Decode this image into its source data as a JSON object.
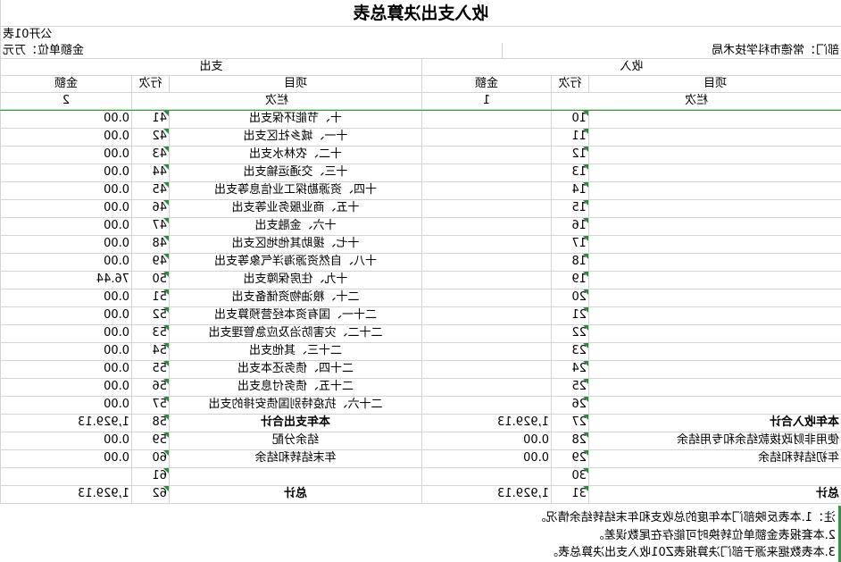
{
  "title": "收入支出决算总表",
  "form_no": "公开01表",
  "department": "部门：常德市科学技术局",
  "unit": "金额单位：万元",
  "headers": {
    "income": "收入",
    "expense": "支出",
    "item": "项目",
    "row_no": "行次",
    "amount": "金额",
    "column": "栏次",
    "col1": "1",
    "col2": "2"
  },
  "rows": [
    {
      "li": "",
      "ln": "10",
      "la": "",
      "ei": "十、节能环保支出",
      "en": "41",
      "ea": "0.00"
    },
    {
      "li": "",
      "ln": "11",
      "la": "",
      "ei": "十一、城乡社区支出",
      "en": "42",
      "ea": "0.00"
    },
    {
      "li": "",
      "ln": "12",
      "la": "",
      "ei": "十二、农林水支出",
      "en": "43",
      "ea": "0.00"
    },
    {
      "li": "",
      "ln": "13",
      "la": "",
      "ei": "十三、交通运输支出",
      "en": "44",
      "ea": "0.00"
    },
    {
      "li": "",
      "ln": "14",
      "la": "",
      "ei": "十四、资源勘探工业信息等支出",
      "en": "45",
      "ea": "0.00"
    },
    {
      "li": "",
      "ln": "15",
      "la": "",
      "ei": "十五、商业服务业等支出",
      "en": "46",
      "ea": "0.00"
    },
    {
      "li": "",
      "ln": "16",
      "la": "",
      "ei": "十六、金融支出",
      "en": "47",
      "ea": "0.00"
    },
    {
      "li": "",
      "ln": "17",
      "la": "",
      "ei": "十七、援助其他地区支出",
      "en": "48",
      "ea": "0.00"
    },
    {
      "li": "",
      "ln": "18",
      "la": "",
      "ei": "十八、自然资源海洋气象等支出",
      "en": "49",
      "ea": "0.00"
    },
    {
      "li": "",
      "ln": "19",
      "la": "",
      "ei": "十九、住房保障支出",
      "en": "50",
      "ea": "76.44"
    },
    {
      "li": "",
      "ln": "20",
      "la": "",
      "ei": "二十、粮油物资储备支出",
      "en": "51",
      "ea": "0.00"
    },
    {
      "li": "",
      "ln": "21",
      "la": "",
      "ei": "二十一、国有资本经营预算支出",
      "en": "52",
      "ea": "0.00"
    },
    {
      "li": "",
      "ln": "22",
      "la": "",
      "ei": "二十二、灾害防治及应急管理支出",
      "en": "53",
      "ea": "0.00"
    },
    {
      "li": "",
      "ln": "23",
      "la": "",
      "ei": "二十三、其他支出",
      "en": "54",
      "ea": "0.00"
    },
    {
      "li": "",
      "ln": "24",
      "la": "",
      "ei": "二十四、债务还本支出",
      "en": "55",
      "ea": "0.00"
    },
    {
      "li": "",
      "ln": "25",
      "la": "",
      "ei": "二十五、债务付息支出",
      "en": "56",
      "ea": "0.00"
    },
    {
      "li": "",
      "ln": "26",
      "la": "",
      "ei": "二十六、抗疫特别国债安排的支出",
      "en": "57",
      "ea": "0.00"
    },
    {
      "li": "本年收入合计",
      "ln": "27",
      "la": "1,929.13",
      "ei": "本年支出合计",
      "en": "58",
      "ea": "1,929.13",
      "bold": true
    },
    {
      "li": "使用非财政拨款结余和专用结余",
      "ln": "28",
      "la": "0.00",
      "ei": "结余分配",
      "en": "59",
      "ea": "0.00"
    },
    {
      "li": "年初结转和结余",
      "ln": "29",
      "la": "0.00",
      "ei": "年末结转和结余",
      "en": "60",
      "ea": "0.00"
    },
    {
      "li": "",
      "ln": "30",
      "la": "",
      "ei": "",
      "en": "61",
      "ea": ""
    },
    {
      "li": "总计",
      "ln": "31",
      "la": "1,929.13",
      "ei": "总计",
      "en": "62",
      "ea": "1,929.13",
      "bold": true
    }
  ],
  "notes": [
    "注：1.本表反映部门本年度的总收支和年末结转结余情况。",
    "2.本套报表金额单位转换时可能存在尾数误差。",
    "3.本表数据来源于部门决算报表Z01收入支出决算总表。"
  ]
}
